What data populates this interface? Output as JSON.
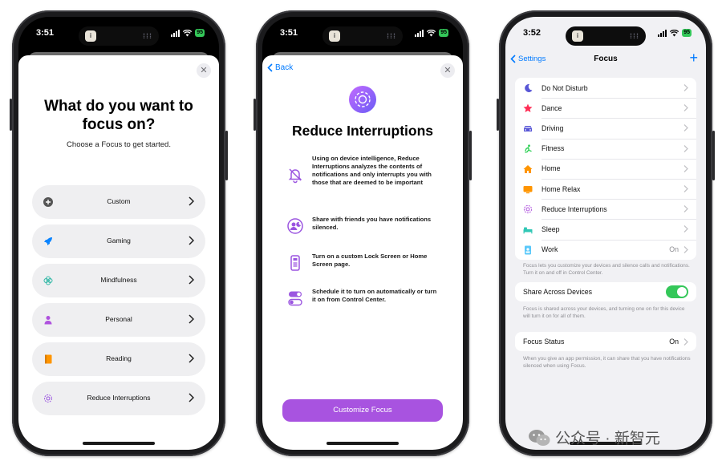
{
  "phone1": {
    "time": "3:51",
    "title": "What do you want to focus on?",
    "subtitle": "Choose a Focus to get started.",
    "close": "✕",
    "options": [
      {
        "label": "Custom",
        "icon": "plus-circle-icon",
        "color": "#555555"
      },
      {
        "label": "Gaming",
        "icon": "rocket-icon",
        "color": "#0a84ff"
      },
      {
        "label": "Mindfulness",
        "icon": "flower-icon",
        "color": "#2fb7a5"
      },
      {
        "label": "Personal",
        "icon": "person-icon",
        "color": "#af52de"
      },
      {
        "label": "Reading",
        "icon": "book-icon",
        "color": "#ff9500"
      },
      {
        "label": "Reduce Interruptions",
        "icon": "interrupt-icon",
        "color": "#9b55e0"
      }
    ]
  },
  "phone2": {
    "time": "3:51",
    "back": "Back",
    "close": "✕",
    "title": "Reduce Interruptions",
    "features": [
      {
        "text": "Using on device intelligence, Reduce Interruptions analyzes the contents of notifications and only interrupts you with those that are deemed to be important",
        "icon": "bell-slash-icon"
      },
      {
        "text": "Share with friends you have notifications silenced.",
        "icon": "person-moon-icon"
      },
      {
        "text": "Turn on a custom Lock Screen or Home Screen page.",
        "icon": "phone-screen-icon"
      },
      {
        "text": "Schedule it to turn on automatically or turn it on from Control Center.",
        "icon": "toggle-icon"
      }
    ],
    "button": "Customize Focus"
  },
  "phone3": {
    "time": "3:52",
    "back": "Settings",
    "title": "Focus",
    "add": "+",
    "focus_items": [
      {
        "label": "Do Not Disturb",
        "value": "",
        "icon": "moon-icon",
        "color": "#5856d6"
      },
      {
        "label": "Dance",
        "value": "",
        "icon": "star-icon",
        "color": "#ff2d55"
      },
      {
        "label": "Driving",
        "value": "",
        "icon": "car-icon",
        "color": "#5856d6"
      },
      {
        "label": "Fitness",
        "value": "",
        "icon": "runner-icon",
        "color": "#30d158"
      },
      {
        "label": "Home",
        "value": "",
        "icon": "house-icon",
        "color": "#ff9500"
      },
      {
        "label": "Home Relax",
        "value": "",
        "icon": "tv-icon",
        "color": "#ff9500"
      },
      {
        "label": "Reduce Interruptions",
        "value": "",
        "icon": "interrupt-icon",
        "color": "#af52de"
      },
      {
        "label": "Sleep",
        "value": "",
        "icon": "bed-icon",
        "color": "#30c7b5"
      },
      {
        "label": "Work",
        "value": "On",
        "icon": "badge-icon",
        "color": "#5ac8fa"
      }
    ],
    "focus_footer": "Focus lets you customize your devices and silence calls and notifications. Turn it on and off in Control Center.",
    "share_label": "Share Across Devices",
    "share_footer": "Focus is shared across your devices, and turning one on for this device will turn it on for all of them.",
    "status_label": "Focus Status",
    "status_value": "On",
    "status_footer": "When you give an app permission, it can share that you have notifications silenced when using Focus."
  },
  "watermark": "公众号 · 新智元",
  "colors": {
    "accent": "#007aff",
    "purple": "#a853e0",
    "green": "#34c759"
  }
}
